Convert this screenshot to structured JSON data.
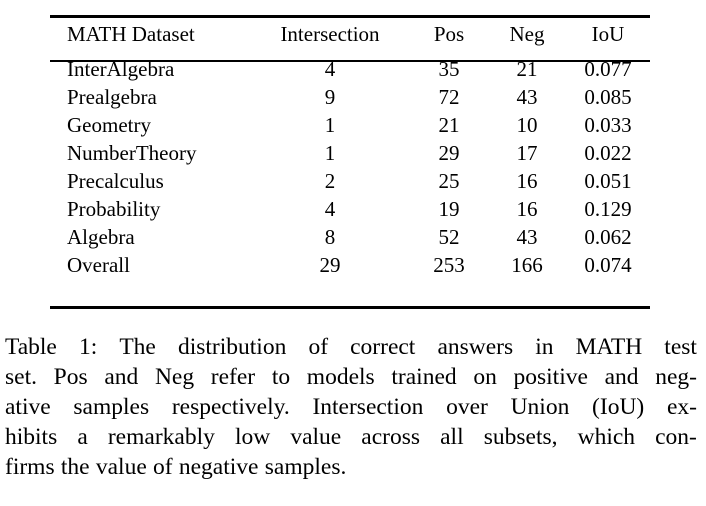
{
  "table": {
    "columns": [
      "MATH Dataset",
      "Intersection",
      "Pos",
      "Neg",
      "IoU"
    ],
    "rows": [
      {
        "dataset": "InterAlgebra",
        "intersection": "4",
        "pos": "35",
        "neg": "21",
        "iou": "0.077"
      },
      {
        "dataset": "Prealgebra",
        "intersection": "9",
        "pos": "72",
        "neg": "43",
        "iou": "0.085"
      },
      {
        "dataset": "Geometry",
        "intersection": "1",
        "pos": "21",
        "neg": "10",
        "iou": "0.033"
      },
      {
        "dataset": "NumberTheory",
        "intersection": "1",
        "pos": "29",
        "neg": "17",
        "iou": "0.022"
      },
      {
        "dataset": "Precalculus",
        "intersection": "2",
        "pos": "25",
        "neg": "16",
        "iou": "0.051"
      },
      {
        "dataset": "Probability",
        "intersection": "4",
        "pos": "19",
        "neg": "16",
        "iou": "0.129"
      },
      {
        "dataset": "Algebra",
        "intersection": "8",
        "pos": "52",
        "neg": "43",
        "iou": "0.062"
      },
      {
        "dataset": "Overall",
        "intersection": "29",
        "pos": "253",
        "neg": "166",
        "iou": "0.074"
      }
    ]
  },
  "caption": {
    "full": "Table 1: The distribution of correct answers in MATH test set. Pos and Neg refer to models trained on positive and negative samples respectively. Intersection over Union (IoU) exhibits a remarkably low value across all subsets, which confirms the value of negative samples.",
    "label": "Table 1:",
    "lines": [
      "Table 1: The distribution of correct answers in MATH test",
      "set. Pos and Neg refer to models trained on positive and neg-",
      "ative samples respectively. Intersection over Union (IoU) ex-",
      "hibits a remarkably low value across all subsets, which con-",
      "firms the value of negative samples."
    ]
  },
  "chart_data": {
    "type": "table",
    "title": "The distribution of correct answers in MATH test set",
    "categories": [
      "InterAlgebra",
      "Prealgebra",
      "Geometry",
      "NumberTheory",
      "Precalculus",
      "Probability",
      "Algebra",
      "Overall"
    ],
    "series": [
      {
        "name": "Intersection",
        "values": [
          4,
          9,
          1,
          1,
          2,
          4,
          8,
          29
        ]
      },
      {
        "name": "Pos",
        "values": [
          35,
          72,
          21,
          29,
          25,
          19,
          52,
          253
        ]
      },
      {
        "name": "Neg",
        "values": [
          21,
          43,
          10,
          17,
          16,
          16,
          43,
          166
        ]
      },
      {
        "name": "IoU",
        "values": [
          0.077,
          0.085,
          0.033,
          0.022,
          0.051,
          0.129,
          0.062,
          0.074
        ]
      }
    ],
    "xlabel": "MATH Dataset",
    "ylabel": "",
    "grid": false,
    "legend": "none"
  }
}
